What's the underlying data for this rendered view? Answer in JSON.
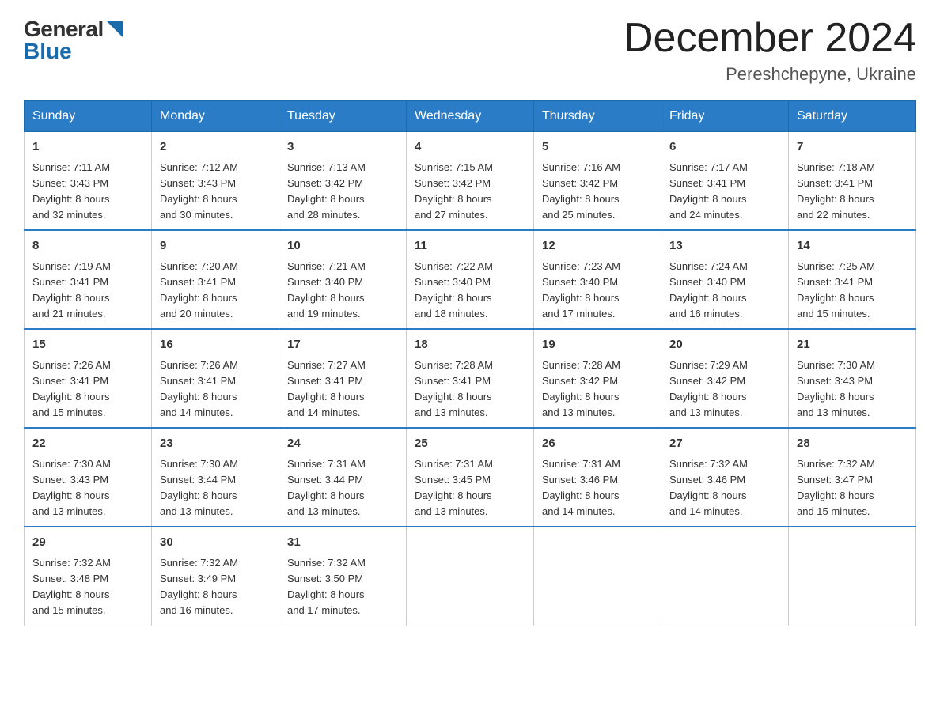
{
  "header": {
    "logo_general": "General",
    "logo_blue": "Blue",
    "month_title": "December 2024",
    "location": "Pereshchepyne, Ukraine"
  },
  "days_of_week": [
    "Sunday",
    "Monday",
    "Tuesday",
    "Wednesday",
    "Thursday",
    "Friday",
    "Saturday"
  ],
  "weeks": [
    [
      {
        "day": "1",
        "sunrise": "7:11 AM",
        "sunset": "3:43 PM",
        "daylight": "8 hours and 32 minutes."
      },
      {
        "day": "2",
        "sunrise": "7:12 AM",
        "sunset": "3:43 PM",
        "daylight": "8 hours and 30 minutes."
      },
      {
        "day": "3",
        "sunrise": "7:13 AM",
        "sunset": "3:42 PM",
        "daylight": "8 hours and 28 minutes."
      },
      {
        "day": "4",
        "sunrise": "7:15 AM",
        "sunset": "3:42 PM",
        "daylight": "8 hours and 27 minutes."
      },
      {
        "day": "5",
        "sunrise": "7:16 AM",
        "sunset": "3:42 PM",
        "daylight": "8 hours and 25 minutes."
      },
      {
        "day": "6",
        "sunrise": "7:17 AM",
        "sunset": "3:41 PM",
        "daylight": "8 hours and 24 minutes."
      },
      {
        "day": "7",
        "sunrise": "7:18 AM",
        "sunset": "3:41 PM",
        "daylight": "8 hours and 22 minutes."
      }
    ],
    [
      {
        "day": "8",
        "sunrise": "7:19 AM",
        "sunset": "3:41 PM",
        "daylight": "8 hours and 21 minutes."
      },
      {
        "day": "9",
        "sunrise": "7:20 AM",
        "sunset": "3:41 PM",
        "daylight": "8 hours and 20 minutes."
      },
      {
        "day": "10",
        "sunrise": "7:21 AM",
        "sunset": "3:40 PM",
        "daylight": "8 hours and 19 minutes."
      },
      {
        "day": "11",
        "sunrise": "7:22 AM",
        "sunset": "3:40 PM",
        "daylight": "8 hours and 18 minutes."
      },
      {
        "day": "12",
        "sunrise": "7:23 AM",
        "sunset": "3:40 PM",
        "daylight": "8 hours and 17 minutes."
      },
      {
        "day": "13",
        "sunrise": "7:24 AM",
        "sunset": "3:40 PM",
        "daylight": "8 hours and 16 minutes."
      },
      {
        "day": "14",
        "sunrise": "7:25 AM",
        "sunset": "3:41 PM",
        "daylight": "8 hours and 15 minutes."
      }
    ],
    [
      {
        "day": "15",
        "sunrise": "7:26 AM",
        "sunset": "3:41 PM",
        "daylight": "8 hours and 15 minutes."
      },
      {
        "day": "16",
        "sunrise": "7:26 AM",
        "sunset": "3:41 PM",
        "daylight": "8 hours and 14 minutes."
      },
      {
        "day": "17",
        "sunrise": "7:27 AM",
        "sunset": "3:41 PM",
        "daylight": "8 hours and 14 minutes."
      },
      {
        "day": "18",
        "sunrise": "7:28 AM",
        "sunset": "3:41 PM",
        "daylight": "8 hours and 13 minutes."
      },
      {
        "day": "19",
        "sunrise": "7:28 AM",
        "sunset": "3:42 PM",
        "daylight": "8 hours and 13 minutes."
      },
      {
        "day": "20",
        "sunrise": "7:29 AM",
        "sunset": "3:42 PM",
        "daylight": "8 hours and 13 minutes."
      },
      {
        "day": "21",
        "sunrise": "7:30 AM",
        "sunset": "3:43 PM",
        "daylight": "8 hours and 13 minutes."
      }
    ],
    [
      {
        "day": "22",
        "sunrise": "7:30 AM",
        "sunset": "3:43 PM",
        "daylight": "8 hours and 13 minutes."
      },
      {
        "day": "23",
        "sunrise": "7:30 AM",
        "sunset": "3:44 PM",
        "daylight": "8 hours and 13 minutes."
      },
      {
        "day": "24",
        "sunrise": "7:31 AM",
        "sunset": "3:44 PM",
        "daylight": "8 hours and 13 minutes."
      },
      {
        "day": "25",
        "sunrise": "7:31 AM",
        "sunset": "3:45 PM",
        "daylight": "8 hours and 13 minutes."
      },
      {
        "day": "26",
        "sunrise": "7:31 AM",
        "sunset": "3:46 PM",
        "daylight": "8 hours and 14 minutes."
      },
      {
        "day": "27",
        "sunrise": "7:32 AM",
        "sunset": "3:46 PM",
        "daylight": "8 hours and 14 minutes."
      },
      {
        "day": "28",
        "sunrise": "7:32 AM",
        "sunset": "3:47 PM",
        "daylight": "8 hours and 15 minutes."
      }
    ],
    [
      {
        "day": "29",
        "sunrise": "7:32 AM",
        "sunset": "3:48 PM",
        "daylight": "8 hours and 15 minutes."
      },
      {
        "day": "30",
        "sunrise": "7:32 AM",
        "sunset": "3:49 PM",
        "daylight": "8 hours and 16 minutes."
      },
      {
        "day": "31",
        "sunrise": "7:32 AM",
        "sunset": "3:50 PM",
        "daylight": "8 hours and 17 minutes."
      },
      null,
      null,
      null,
      null
    ]
  ],
  "labels": {
    "sunrise": "Sunrise:",
    "sunset": "Sunset:",
    "daylight": "Daylight:"
  }
}
